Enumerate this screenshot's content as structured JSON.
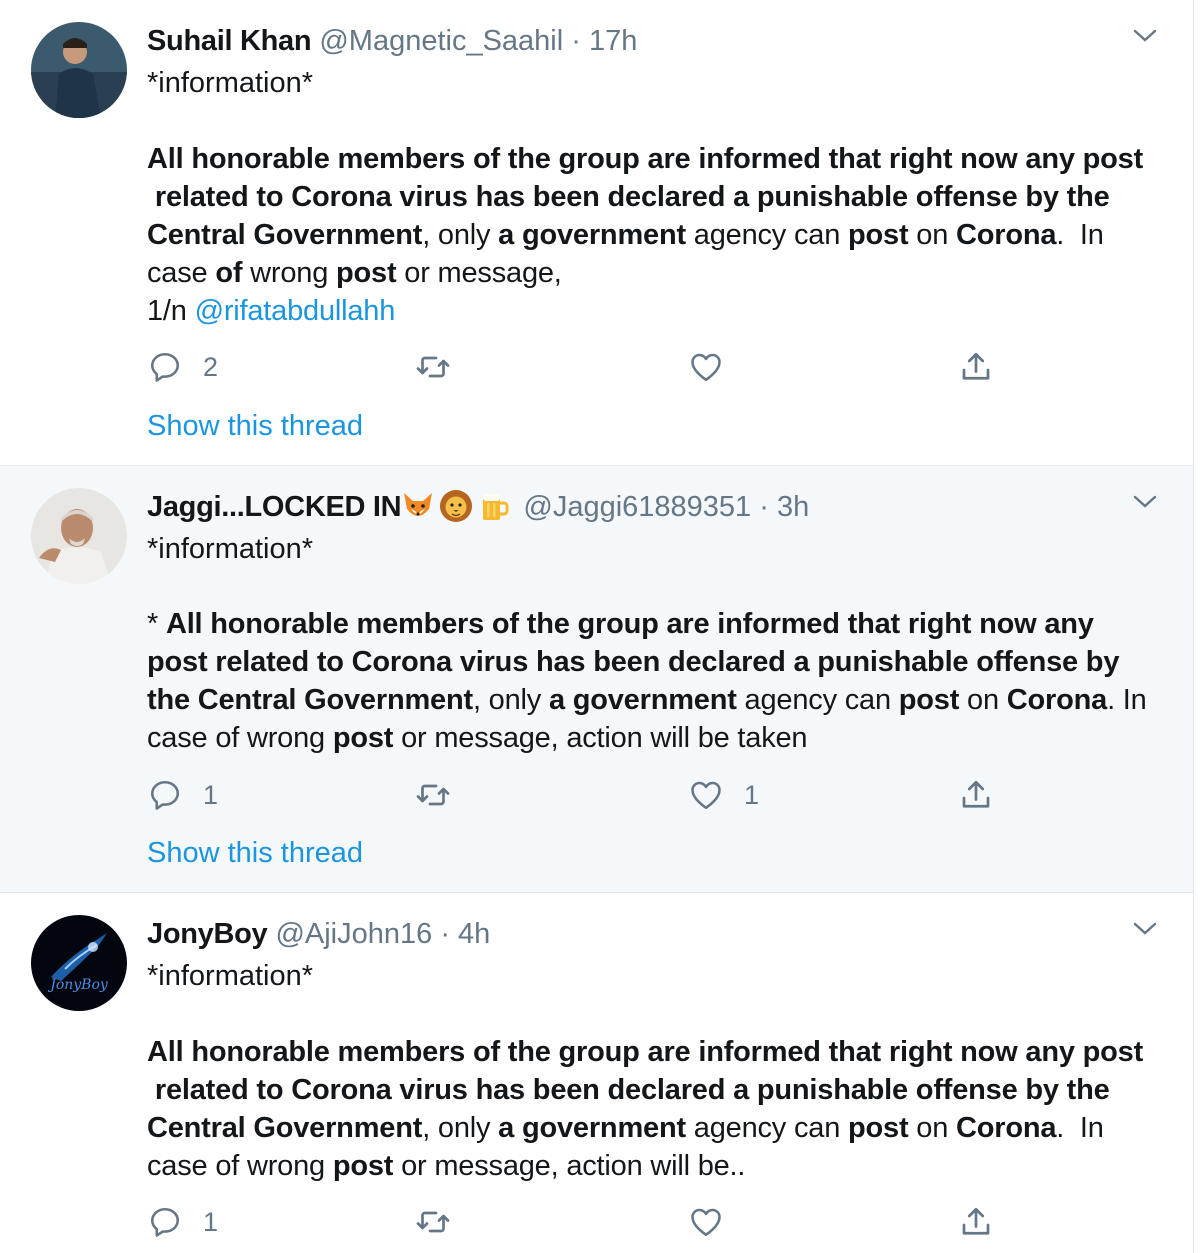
{
  "colors": {
    "link": "#1b95e0",
    "muted": "#657786",
    "text": "#14171a",
    "highlight_bg": "#f5f8fa"
  },
  "tweets": [
    {
      "name": "Suhail Khan",
      "handle": "@Magnetic_Saahil",
      "dot": "·",
      "time": "17h",
      "line1": "*information*",
      "body": [
        {
          "b": "All honorable members of the group are informed that right now any post"
        },
        {
          "br": true
        },
        {
          "t": " "
        },
        {
          "b": "related to Corona virus has been declared a punishable offense by the"
        },
        {
          "br": true
        },
        {
          "b": "Central Government"
        },
        {
          "t": ", only "
        },
        {
          "b": "a government"
        },
        {
          "t": " agency can "
        },
        {
          "b": "post"
        },
        {
          "t": " on "
        },
        {
          "b": "Corona"
        },
        {
          "t": ".  In"
        },
        {
          "br": true
        },
        {
          "t": "case "
        },
        {
          "b": "of"
        },
        {
          "t": " wrong "
        },
        {
          "b": "post"
        },
        {
          "t": " or message,"
        },
        {
          "br": true
        },
        {
          "t": "1/n "
        },
        {
          "m": "@rifatabdullahh"
        }
      ],
      "reply_count": "2",
      "retweet_count": "",
      "like_count": "",
      "show_thread": "Show this thread"
    },
    {
      "name": "Jaggi...LOCKED IN",
      "handle": "@Jaggi61889351",
      "dot": "·",
      "time": "3h",
      "line1": "*information*",
      "body": [
        {
          "t": "* "
        },
        {
          "b": "All honorable members of the group are informed that right now any"
        },
        {
          "br": true
        },
        {
          "b": "post related to Corona virus has been declared a punishable offense by"
        },
        {
          "br": true
        },
        {
          "b": "the Central Government"
        },
        {
          "t": ", only "
        },
        {
          "b": "a government"
        },
        {
          "t": " agency can "
        },
        {
          "b": "post"
        },
        {
          "t": " on "
        },
        {
          "b": "Corona"
        },
        {
          "t": ". In"
        },
        {
          "br": true
        },
        {
          "t": "case of wrong "
        },
        {
          "b": "post"
        },
        {
          "t": " or message, action will be taken"
        }
      ],
      "reply_count": "1",
      "retweet_count": "",
      "like_count": "1",
      "show_thread": "Show this thread"
    },
    {
      "name": "JonyBoy",
      "handle": "@AjiJohn16",
      "dot": "·",
      "time": "4h",
      "line1": "*information*",
      "avatar_text": "JonyBoy",
      "body": [
        {
          "b": "All honorable members of the group are informed that right now any post"
        },
        {
          "br": true
        },
        {
          "t": " "
        },
        {
          "b": "related to Corona virus has been declared a punishable offense by the"
        },
        {
          "br": true
        },
        {
          "b": "Central Government"
        },
        {
          "t": ", only "
        },
        {
          "b": "a government"
        },
        {
          "t": " agency can "
        },
        {
          "b": "post"
        },
        {
          "t": " on "
        },
        {
          "b": "Corona"
        },
        {
          "t": ".  In"
        },
        {
          "br": true
        },
        {
          "t": "case of wrong "
        },
        {
          "b": "post"
        },
        {
          "t": " or message, action will be.."
        }
      ],
      "reply_count": "1",
      "retweet_count": "",
      "like_count": ""
    }
  ]
}
